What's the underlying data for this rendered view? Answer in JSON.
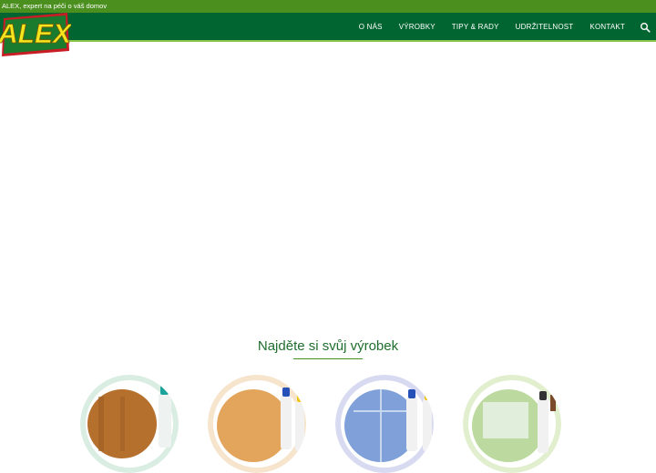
{
  "topbar": {
    "tagline": "ALEX, expert na péči o váš domov"
  },
  "brand": {
    "logo_text": "ALEX",
    "logo_color": "#f4e51e",
    "logo_stroke": "#c81d25"
  },
  "nav": {
    "items": [
      {
        "label": "O NÁS"
      },
      {
        "label": "VÝROBKY"
      },
      {
        "label": "TIPY & RADY"
      },
      {
        "label": "UDRŽITELNOST"
      },
      {
        "label": "KONTAKT"
      }
    ],
    "search_icon": "search-icon"
  },
  "products": {
    "title": "Najděte si svůj výrobek",
    "categories": [
      {
        "icon": "wood-floor-cleaner-icon",
        "ring_color": "#cfe6d8"
      },
      {
        "icon": "laminate-cleaner-icon",
        "ring_color": "#f3dcc0"
      },
      {
        "icon": "tile-cleaner-icon",
        "ring_color": "#cfd3ee"
      },
      {
        "icon": "glass-cleaner-icon",
        "ring_color": "#dcebc6"
      }
    ]
  },
  "colors": {
    "topbar": "#4b8f1f",
    "navbar": "#006530",
    "accent": "#8bc34a",
    "title": "#1f6e2e"
  }
}
